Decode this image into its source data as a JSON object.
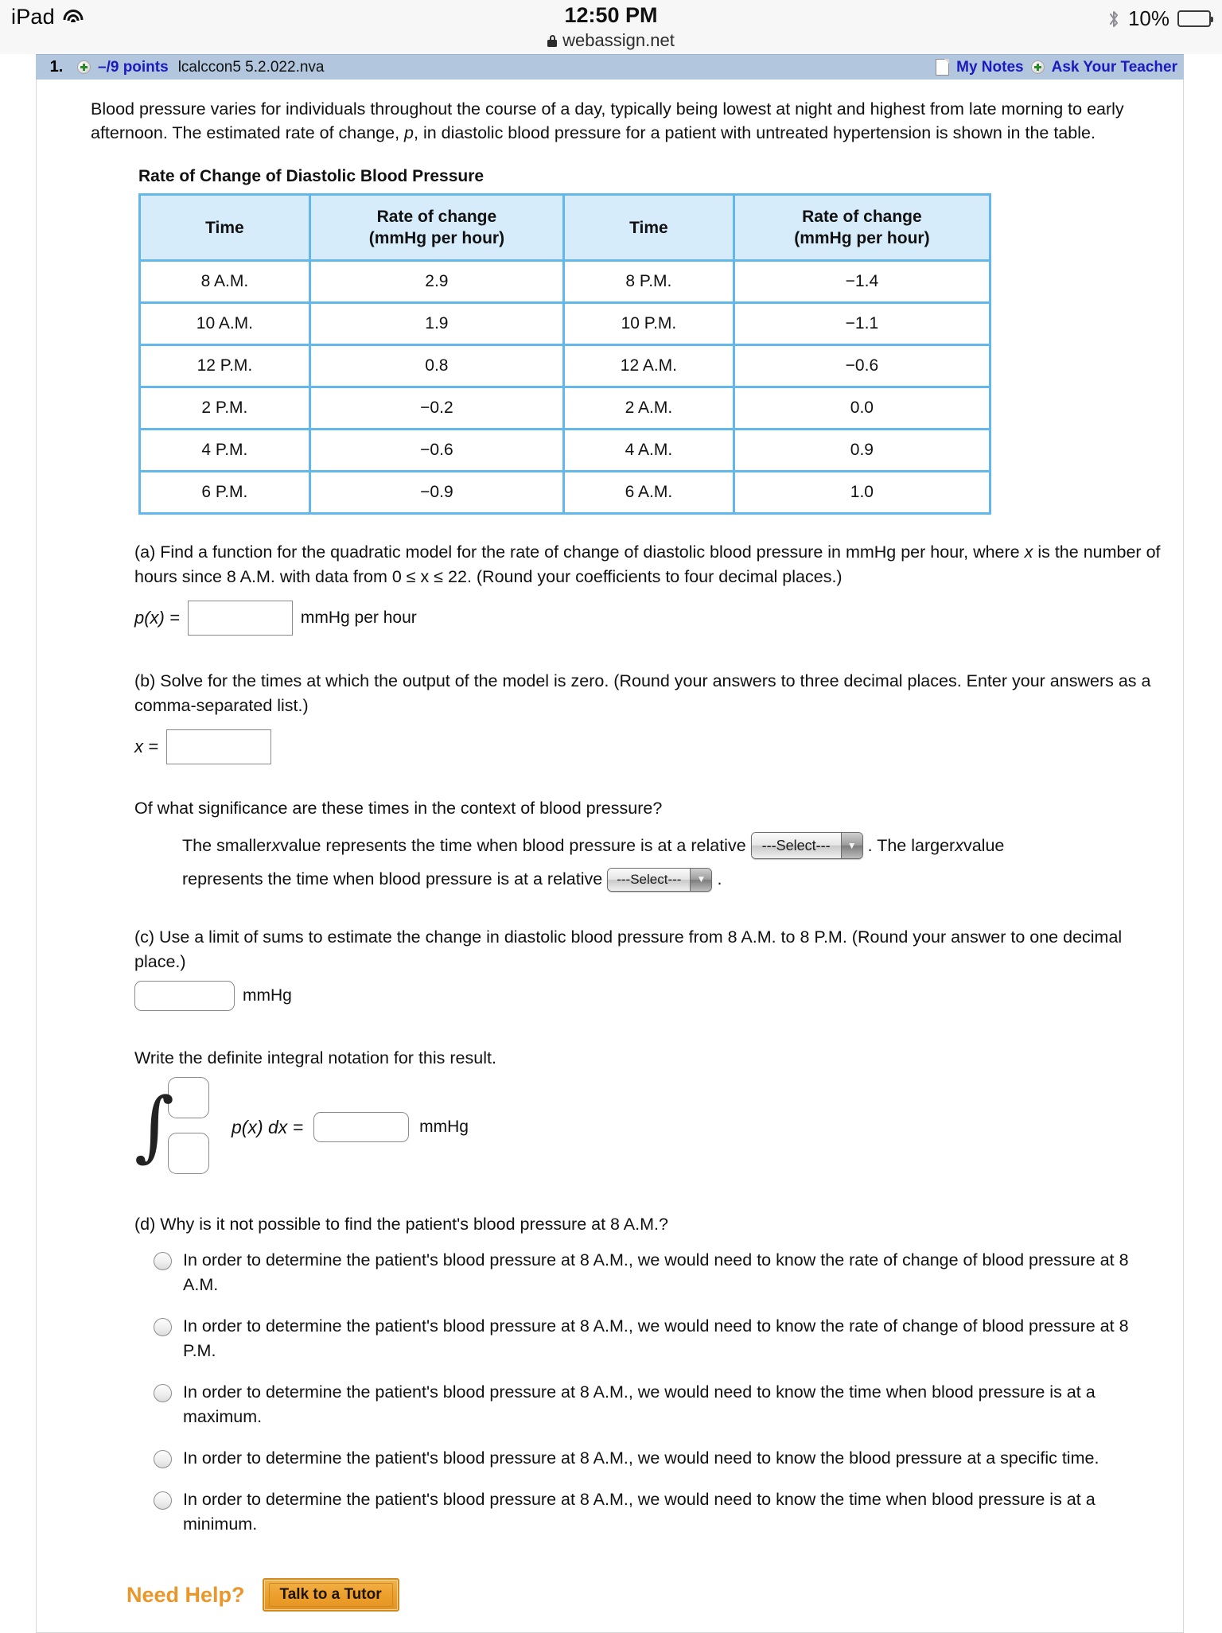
{
  "statusbar": {
    "device": "iPad",
    "time": "12:50 PM",
    "url": "webassign.net",
    "battery_pct": "10%",
    "battery_fill_pct": 13,
    "battery_color": "#f9432b"
  },
  "question_header": {
    "number": "1.",
    "points": "–/9 points",
    "code": "lcalccon5 5.2.022.nva",
    "my_notes": "My Notes",
    "ask_teacher": "Ask Your Teacher",
    "bar_color": "#b2c6de",
    "link_color": "#1b1bbd"
  },
  "intro": {
    "text_1": "Blood pressure varies for individuals throughout the course of a day, typically being lowest at night and highest from late morning to early afternoon. The estimated rate of change, ",
    "var_p": "p",
    "text_2": ", in diastolic blood pressure for a patient with untreated hypertension is shown in the table."
  },
  "table": {
    "title": "Rate of Change of Diastolic Blood Pressure",
    "header_bg": "#d7ecfa",
    "border_color": "#62b8ea",
    "value_color": "#e8392c",
    "columns": [
      "Time",
      "Rate of change\n(mmHg per hour)",
      "Time",
      "Rate of change\n(mmHg per hour)"
    ],
    "col_head_1": "Time",
    "col_head_2a": "Rate of change",
    "col_head_2b": "(mmHg per hour)",
    "col_head_3": "Time",
    "col_head_4a": "Rate of change",
    "col_head_4b": "(mmHg per hour)",
    "rows": [
      {
        "time_left": "8 A.M.",
        "rate_left": "2.9",
        "time_right": "8 P.M.",
        "rate_right": "−1.4"
      },
      {
        "time_left": "10 A.M.",
        "rate_left": "1.9",
        "time_right": "10 P.M.",
        "rate_right": "−1.1"
      },
      {
        "time_left": "12 P.M.",
        "rate_left": "0.8",
        "time_right": "12 A.M.",
        "rate_right": "−0.6"
      },
      {
        "time_left": "2 P.M.",
        "rate_left": "−0.2",
        "time_right": "2 A.M.",
        "rate_right": "0.0"
      },
      {
        "time_left": "4 P.M.",
        "rate_left": "−0.6",
        "time_right": "4 A.M.",
        "rate_right": "0.9"
      },
      {
        "time_left": "6 P.M.",
        "rate_left": "−0.9",
        "time_right": "6 A.M.",
        "rate_right": "1.0"
      }
    ]
  },
  "part_a": {
    "prompt_1": "(a) Find a function for the quadratic model for the rate of change of diastolic blood pressure in mmHg per hour, where ",
    "var_x": "x",
    "prompt_2": " is the number of hours since 8 A.M. with data from  0 ≤ x ≤ 22.  (Round your coefficients to four decimal places.)",
    "label": "p(x) =",
    "input_value": "",
    "unit": "mmHg per hour"
  },
  "part_b": {
    "prompt": "(b) Solve for the times at which the output of the model is zero. (Round your answers to three decimal places. Enter your answers as a comma-separated list.)",
    "label": "x =",
    "input_value": "",
    "significance_question": "Of what significance are these times in the context of blood pressure?",
    "sentence_1a": "The smaller ",
    "sentence_1b": " value represents the time when blood pressure is at a relative",
    "sentence_1c": ". The larger ",
    "sentence_1d": " value",
    "sentence_2": "represents the time when blood pressure is at a relative",
    "select_placeholder": "---Select---",
    "period": "."
  },
  "part_c": {
    "prompt": "(c) Use a limit of sums to estimate the change in diastolic blood pressure from 8 A.M. to 8 P.M. (Round your answer to one decimal place.)",
    "input_value": "",
    "unit": "mmHg",
    "integral_prompt": "Write the definite integral notation for this result.",
    "upper_bound": "",
    "lower_bound": "",
    "integrand": "p(x) dx =",
    "integral_value": "",
    "integral_unit": "mmHg"
  },
  "part_d": {
    "prompt": "(d) Why is it not possible to find the patient's blood pressure at 8 A.M.?",
    "options": [
      "In order to determine the patient's blood pressure at 8 A.M., we would need to know the rate of change of blood pressure at 8 A.M.",
      "In order to determine the patient's blood pressure at 8 A.M., we would need to know the rate of change of blood pressure at 8 P.M.",
      "In order to determine the patient's blood pressure at 8 A.M., we would need to know the time when blood pressure is at a maximum.",
      "In order to determine the patient's blood pressure at 8 A.M., we would need to know the blood pressure at a specific time.",
      "In order to determine the patient's blood pressure at 8 A.M., we would need to know the time when blood pressure is at a minimum."
    ]
  },
  "footer": {
    "need_help": "Need Help?",
    "tutor_button": "Talk to a Tutor",
    "accent_color": "#e9962a"
  }
}
